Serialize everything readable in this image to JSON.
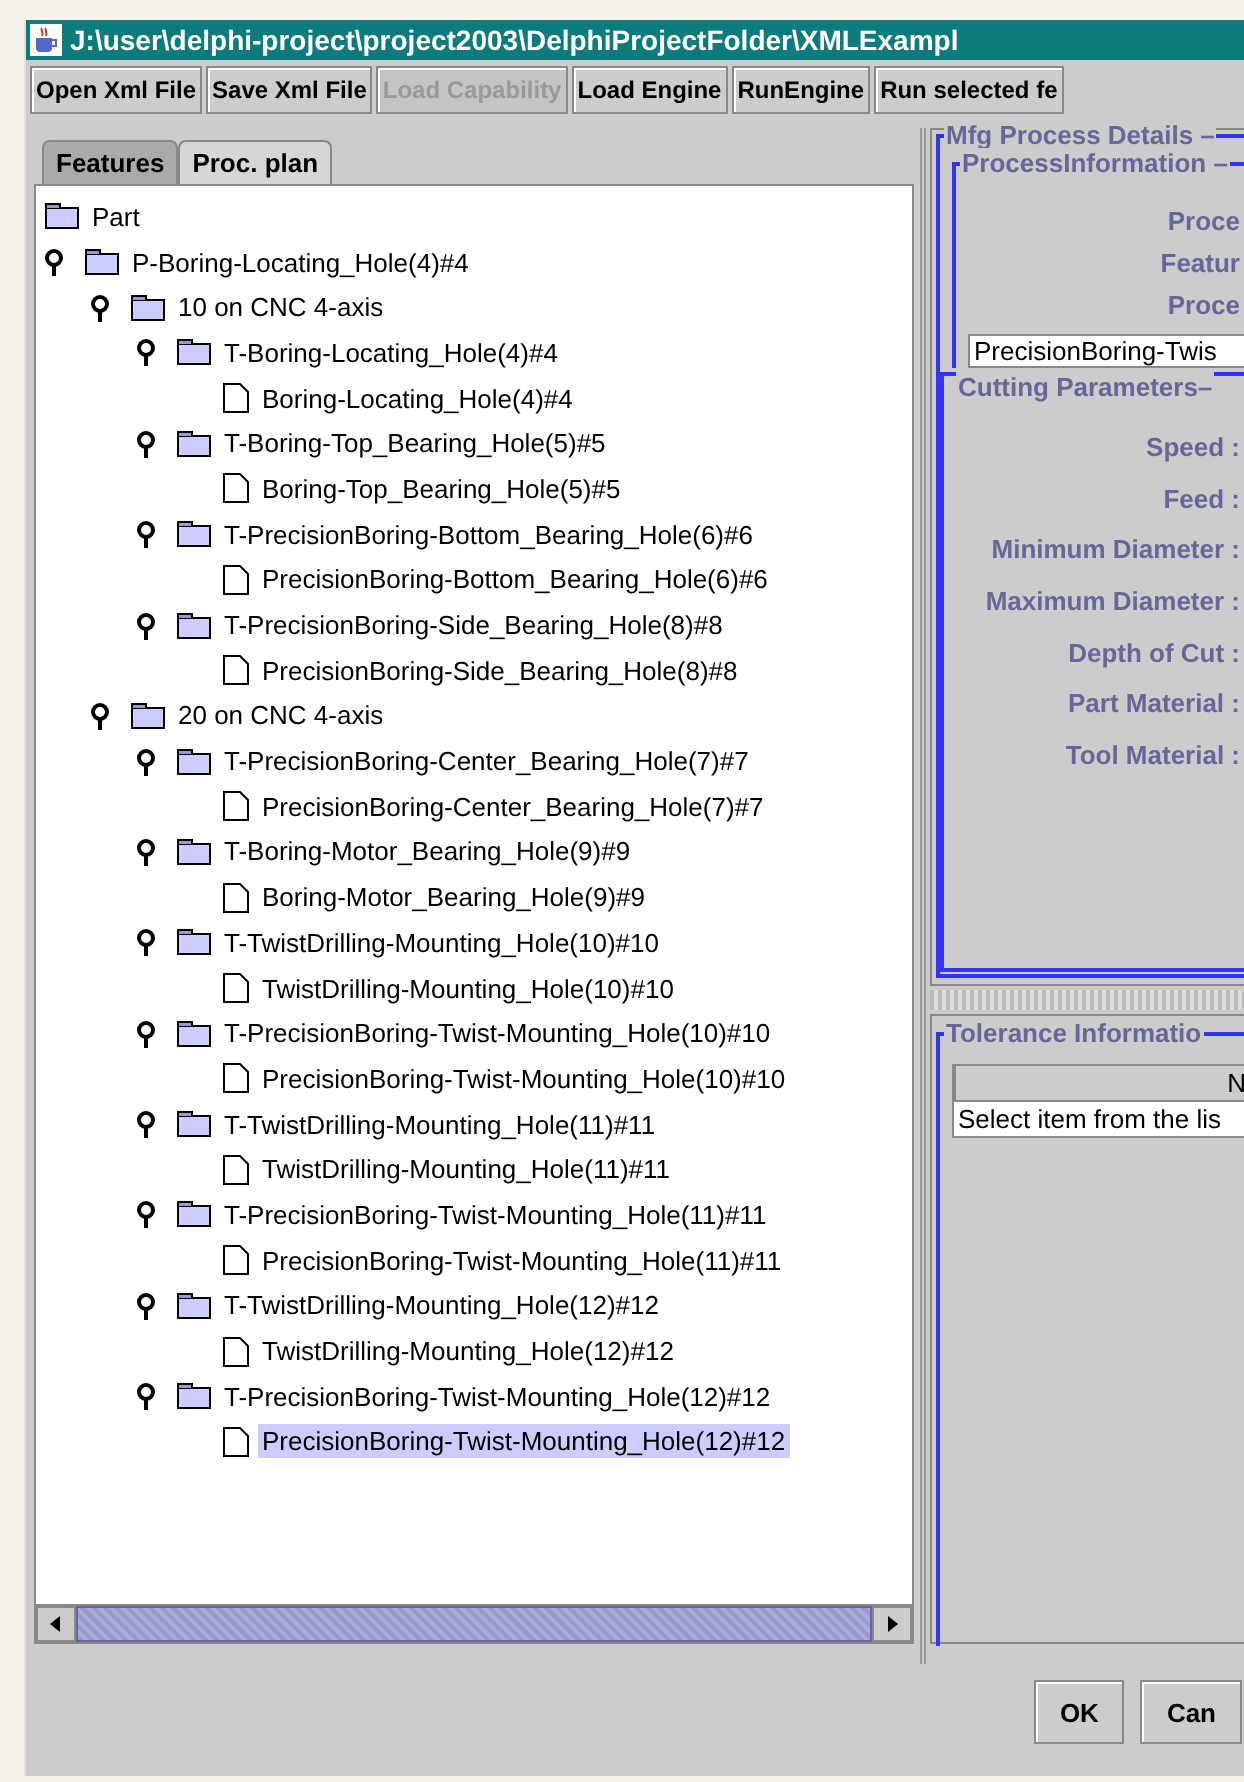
{
  "window": {
    "title": "J:\\user\\delphi-project\\project2003\\DelphiProjectFolder\\XMLExampl"
  },
  "toolbar": [
    {
      "label": "Open Xml File",
      "disabled": false
    },
    {
      "label": "Save Xml File",
      "disabled": false
    },
    {
      "label": "Load Capability",
      "disabled": true
    },
    {
      "label": "Load Engine",
      "disabled": false
    },
    {
      "label": "RunEngine",
      "disabled": false
    },
    {
      "label": "Run selected fe",
      "disabled": false
    }
  ],
  "tabs": [
    {
      "label": "Features",
      "selected": false
    },
    {
      "label": "Proc. plan",
      "selected": true
    }
  ],
  "tree": {
    "label": "Part",
    "kind": "folder",
    "selected": false,
    "children": [
      {
        "label": "P-Boring-Locating_Hole(4)#4",
        "kind": "folder",
        "expanded": true,
        "selected": false,
        "children": [
          {
            "label": "10 on CNC 4-axis",
            "kind": "folder",
            "expanded": true,
            "selected": false,
            "children": [
              {
                "label": "T-Boring-Locating_Hole(4)#4",
                "kind": "folder",
                "expanded": true,
                "selected": false,
                "children": [
                  {
                    "label": "Boring-Locating_Hole(4)#4",
                    "kind": "file",
                    "selected": false
                  }
                ]
              },
              {
                "label": "T-Boring-Top_Bearing_Hole(5)#5",
                "kind": "folder",
                "expanded": true,
                "selected": false,
                "children": [
                  {
                    "label": "Boring-Top_Bearing_Hole(5)#5",
                    "kind": "file",
                    "selected": false
                  }
                ]
              },
              {
                "label": "T-PrecisionBoring-Bottom_Bearing_Hole(6)#6",
                "kind": "folder",
                "expanded": true,
                "selected": false,
                "children": [
                  {
                    "label": "PrecisionBoring-Bottom_Bearing_Hole(6)#6",
                    "kind": "file",
                    "selected": false
                  }
                ]
              },
              {
                "label": "T-PrecisionBoring-Side_Bearing_Hole(8)#8",
                "kind": "folder",
                "expanded": true,
                "selected": false,
                "children": [
                  {
                    "label": "PrecisionBoring-Side_Bearing_Hole(8)#8",
                    "kind": "file",
                    "selected": false
                  }
                ]
              }
            ]
          },
          {
            "label": "20 on CNC 4-axis",
            "kind": "folder",
            "expanded": true,
            "selected": false,
            "children": [
              {
                "label": "T-PrecisionBoring-Center_Bearing_Hole(7)#7",
                "kind": "folder",
                "expanded": true,
                "selected": false,
                "children": [
                  {
                    "label": "PrecisionBoring-Center_Bearing_Hole(7)#7",
                    "kind": "file",
                    "selected": false
                  }
                ]
              },
              {
                "label": "T-Boring-Motor_Bearing_Hole(9)#9",
                "kind": "folder",
                "expanded": true,
                "selected": false,
                "children": [
                  {
                    "label": "Boring-Motor_Bearing_Hole(9)#9",
                    "kind": "file",
                    "selected": false
                  }
                ]
              },
              {
                "label": "T-TwistDrilling-Mounting_Hole(10)#10",
                "kind": "folder",
                "expanded": true,
                "selected": false,
                "children": [
                  {
                    "label": "TwistDrilling-Mounting_Hole(10)#10",
                    "kind": "file",
                    "selected": false
                  }
                ]
              },
              {
                "label": "T-PrecisionBoring-Twist-Mounting_Hole(10)#10",
                "kind": "folder",
                "expanded": true,
                "selected": false,
                "children": [
                  {
                    "label": "PrecisionBoring-Twist-Mounting_Hole(10)#10",
                    "kind": "file",
                    "selected": false
                  }
                ]
              },
              {
                "label": "T-TwistDrilling-Mounting_Hole(11)#11",
                "kind": "folder",
                "expanded": true,
                "selected": false,
                "children": [
                  {
                    "label": "TwistDrilling-Mounting_Hole(11)#11",
                    "kind": "file",
                    "selected": false
                  }
                ]
              },
              {
                "label": "T-PrecisionBoring-Twist-Mounting_Hole(11)#11",
                "kind": "folder",
                "expanded": true,
                "selected": false,
                "children": [
                  {
                    "label": "PrecisionBoring-Twist-Mounting_Hole(11)#11",
                    "kind": "file",
                    "selected": false
                  }
                ]
              },
              {
                "label": "T-TwistDrilling-Mounting_Hole(12)#12",
                "kind": "folder",
                "expanded": true,
                "selected": false,
                "children": [
                  {
                    "label": "TwistDrilling-Mounting_Hole(12)#12",
                    "kind": "file",
                    "selected": false
                  }
                ]
              },
              {
                "label": "T-PrecisionBoring-Twist-Mounting_Hole(12)#12",
                "kind": "folder",
                "expanded": true,
                "selected": false,
                "children": [
                  {
                    "label": "PrecisionBoring-Twist-Mounting_Hole(12)#12",
                    "kind": "file",
                    "selected": true
                  }
                ]
              }
            ]
          }
        ]
      }
    ]
  },
  "details": {
    "title": "Mfg Process Details –",
    "process_info": {
      "title": "ProcessInformation –",
      "labels": [
        "Proce",
        "Featur",
        "Proce"
      ],
      "field_value": "PrecisionBoring-Twis"
    },
    "cutting": {
      "title": "Cutting Parameters–",
      "labels": [
        "Speed :",
        "Feed :",
        "Minimum Diameter :",
        "Maximum Diameter :",
        "Depth of Cut :",
        "Part Material :",
        "Tool Material :"
      ]
    }
  },
  "tolerance": {
    "title": "Tolerance Informatio",
    "column_1": "N",
    "rows": [
      "Select item from the lis"
    ]
  },
  "buttons": [
    "OK",
    "Can"
  ]
}
